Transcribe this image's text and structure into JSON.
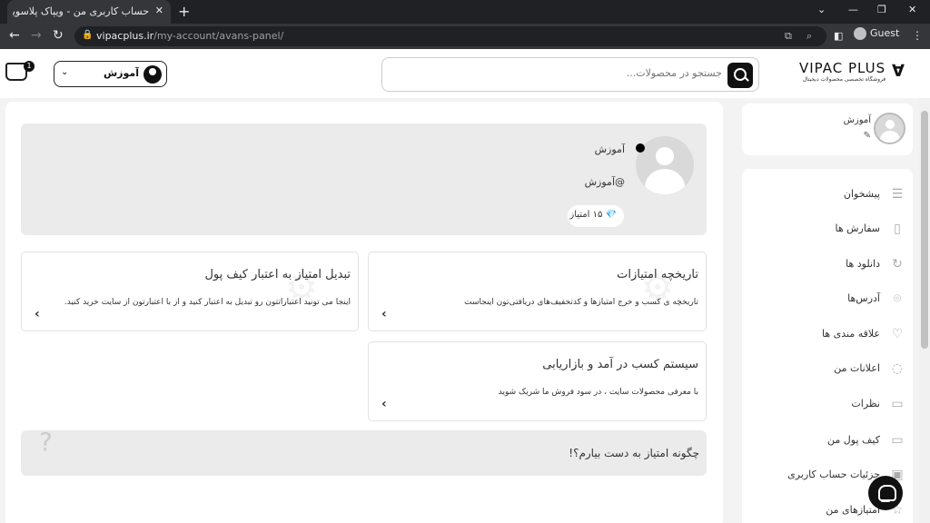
{
  "browser": {
    "tab_title": "حساب کاربری من - ویپاک پلاسویپاک",
    "tab_close": "✕",
    "new_tab": "+",
    "url_host": "vipacplus.ir",
    "url_path": "/my-account/avans-panel/",
    "profile_label": "Guest",
    "window_controls": [
      "⌄",
      "—",
      "❐",
      "✕"
    ]
  },
  "header": {
    "cart_count": "1",
    "user_button_label": "آموزش",
    "search_placeholder": "جستجو در محصولات...",
    "logo_name": "VIPAC PLUS",
    "logo_tagline": "فروشگاه تخصصی محصولات دیجیتال"
  },
  "profile": {
    "name": "آموزش",
    "handle": "آموزش@",
    "points_value": "۱۵",
    "points_label": "امتیاز"
  },
  "cards": {
    "history": {
      "title": "تاریخچه امتیازات",
      "desc": "تاریخچه ی کسب و خرج امتیازها و کدتخفیف‌های دریافتی‌تون اینجاست"
    },
    "convert": {
      "title": "تبدیل امتیاز به اعتبار کیف پول",
      "desc": "اینجا می تونید اعتباراتتون رو تبدیل به اعتبار کنید و از با اعتبارتون از سایت خرید کنید."
    },
    "earn": {
      "title": "سیستم کسب در آمد و بازاریابی",
      "desc": "با معرفی محصولات سایت ، در سود فروش ما شریک شوید"
    },
    "how": {
      "title": "چگونه امتیاز به دست بیارم؟!"
    }
  },
  "sidebar": {
    "user_name": "آموزش",
    "items": [
      {
        "label": "پیشخوان",
        "icon": "sliders-icon"
      },
      {
        "label": "سفارش ها",
        "icon": "document-icon"
      },
      {
        "label": "دانلود ها",
        "icon": "refresh-icon"
      },
      {
        "label": "آدرس‌ها",
        "icon": "location-icon"
      },
      {
        "label": "علاقه مندی ها",
        "icon": "heart-icon"
      },
      {
        "label": "اعلانات من",
        "icon": "bell-icon"
      },
      {
        "label": "نظرات",
        "icon": "comment-icon"
      },
      {
        "label": "کیف پول من",
        "icon": "wallet-icon"
      },
      {
        "label": "جزئیات حساب کاربری",
        "icon": "user-card-icon"
      },
      {
        "label": "امتیازهای من",
        "icon": "star-icon"
      }
    ]
  }
}
